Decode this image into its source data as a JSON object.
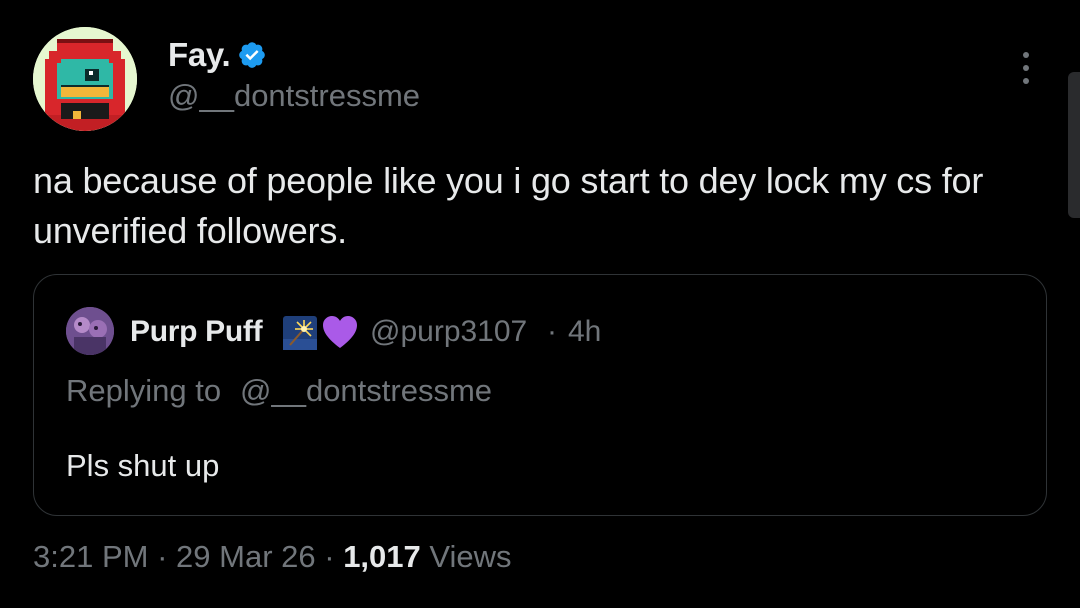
{
  "tweet": {
    "author": {
      "name": "Fay.",
      "handle": "@__dontstressme",
      "verified": true,
      "avatar_icon": "pixel-frog-red-hood-avatar",
      "verified_color": "#1d9bf0"
    },
    "text": "na because of people like you i go start to dey lock my cs for unverified followers.",
    "more_icon": "more-options-icon",
    "quote": {
      "author_name": "Purp Puff",
      "author_emojis": [
        "sparkler-emoji",
        "purple-heart-emoji"
      ],
      "handle": "@purp3107",
      "separator": "·",
      "time": "4h",
      "replying_prefix": "Replying to",
      "replying_handle": "@__dontstressme",
      "text": "Pls shut up"
    },
    "meta": {
      "time": "3:21 PM",
      "sep1": "·",
      "date": "29 Mar 26",
      "sep2": "·",
      "views_count": "1,017",
      "views_label": "Views"
    }
  },
  "colors": {
    "background": "#000000",
    "primary_text": "#e7e9ea",
    "secondary_text": "#71767b",
    "border": "#2f3336",
    "verified": "#1d9bf0"
  }
}
